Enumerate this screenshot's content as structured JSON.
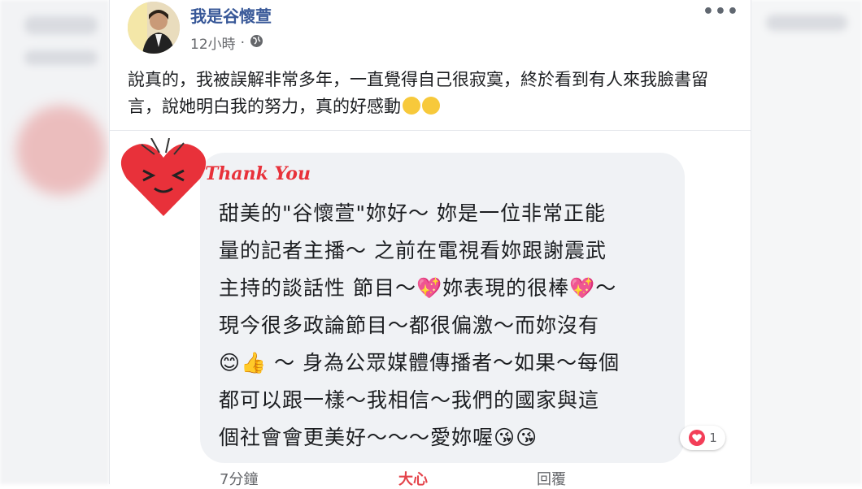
{
  "post": {
    "author": "我是谷懷萱",
    "time": "12小時",
    "separator": "·",
    "more_label": "•••",
    "text": "說真的，我被誤解非常多年，一直覺得自己很寂寞，終於看到有人來我臉書留言，說她明白我的努力，真的好感動"
  },
  "comment": {
    "header": "Thank You",
    "lines": [
      "甜美的\"谷懷萱\"妳好～ 妳是一位非常正能",
      "量的記者主播～ 之前在電視看妳跟謝震武",
      "主持的談話性 節目～💖妳表現的很棒💖～",
      "現今很多政論節目～都很偏激～而妳沒有",
      "😊👍 ～ 身為公眾媒體傳播者～如果～每個",
      "都可以跟一樣～我相信～我們的國家與這",
      "個社會會更美好～～～愛妳喔😘😘"
    ],
    "reaction_count": "1",
    "time": "7分鐘",
    "like_label": "大心",
    "reply_label": "回覆"
  },
  "colors": {
    "author": "#385898",
    "like": "#e4434a",
    "bubble": "#f0f2f5"
  },
  "icons": {
    "globe": "globe-icon",
    "more": "more-icon",
    "heart": "heart-icon"
  }
}
